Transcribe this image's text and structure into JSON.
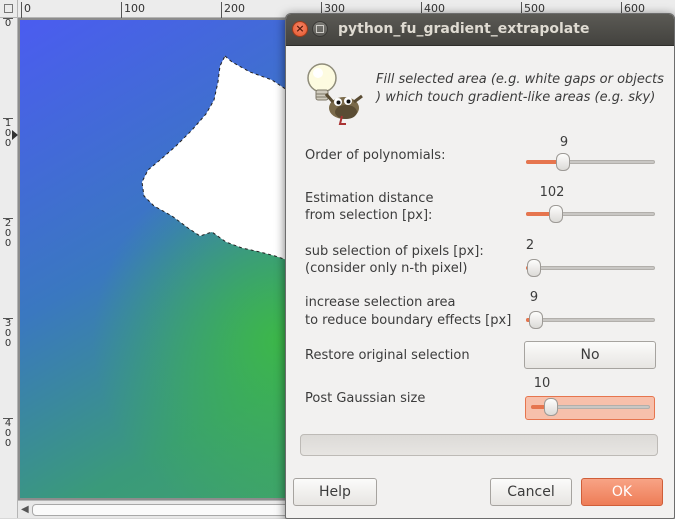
{
  "rulers": {
    "horizontal": [
      "0",
      "100",
      "200",
      "300",
      "400",
      "500",
      "600"
    ],
    "vertical": [
      "0",
      "1\n0\n0",
      "2\n0\n0",
      "3\n0\n0",
      "4\n0\n0"
    ]
  },
  "dialog": {
    "title": "python_fu_gradient_extrapolate",
    "description": "Fill selected area (e.g. white gaps or objects ) which touch gradient-like areas (e.g. sky)",
    "params": [
      {
        "label_line1": "Order of polynomials:",
        "label_line2": "",
        "value": "9",
        "fraction": 0.26
      },
      {
        "label_line1": "Estimation distance",
        "label_line2": "from selection [px]:",
        "value": "102",
        "fraction": 0.2
      },
      {
        "label_line1": "sub selection of pixels [px]:",
        "label_line2": "(consider only n-th pixel)",
        "value": "2",
        "fraction": 0.01
      },
      {
        "label_line1": "increase selection area",
        "label_line2": "to reduce boundary effects [px]",
        "value": "9",
        "fraction": 0.03
      },
      {
        "label_line1": "Post Gaussian size",
        "label_line2": "",
        "value": "10",
        "fraction": 0.12
      }
    ],
    "restore_label": "Restore original selection",
    "restore_value": "No",
    "buttons": {
      "help": "Help",
      "cancel": "Cancel",
      "ok": "OK"
    }
  },
  "colors": {
    "accent": "#ee7d57",
    "titlebar": "#4b4a46"
  }
}
